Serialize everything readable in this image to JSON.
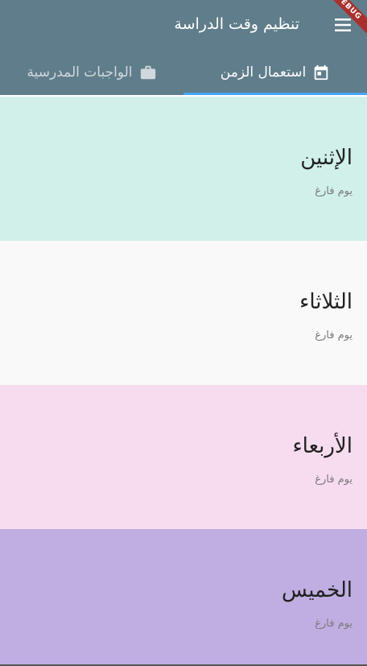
{
  "appbar": {
    "title": "تنظيم وقت الدراسة",
    "menu_icon": "hamburger-menu-icon",
    "debug_label": "DEBUG",
    "background": "#607d8b"
  },
  "tabs": [
    {
      "label": "استعمال الزمن",
      "icon": "calendar-icon",
      "active": true
    },
    {
      "label": "الواجبات المدرسية",
      "icon": "briefcase-icon",
      "active": false
    }
  ],
  "indicator_color": "#42a5f5",
  "days": [
    {
      "name": "الإثنين",
      "status": "يوم فارغ",
      "color": "#d1f0ea"
    },
    {
      "name": "الثلاثاء",
      "status": "يوم فارغ",
      "color": "#f9f9f9"
    },
    {
      "name": "الأربعاء",
      "status": "يوم فارغ",
      "color": "#f7dcf0"
    },
    {
      "name": "الخميس",
      "status": "يوم فارغ",
      "color": "#c0aee2"
    }
  ]
}
